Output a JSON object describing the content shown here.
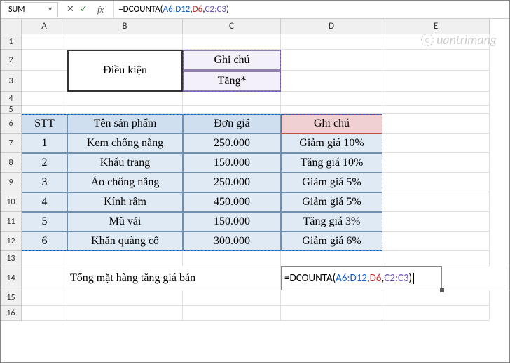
{
  "nameBox": "SUM",
  "formulaBar": {
    "prefix": "=DCOUNTA(",
    "arg1": "A6:D12",
    "sep1": ",",
    "arg2": "D6",
    "sep2": ",",
    "arg3": "C2:C3",
    "suffix": ")"
  },
  "columns": [
    "A",
    "B",
    "C",
    "D",
    "E"
  ],
  "rows": [
    "1",
    "2",
    "3",
    "4",
    "5",
    "6",
    "7",
    "8",
    "9",
    "10",
    "11",
    "12",
    "13",
    "14",
    "15",
    "16"
  ],
  "criteria": {
    "label": "Điều kiện",
    "header": "Ghi chú",
    "value": "Tăng*"
  },
  "table": {
    "headers": {
      "stt": "STT",
      "ten": "Tên sản phẩm",
      "dongia": "Đơn giá",
      "ghichu": "Ghi chú"
    },
    "rows": [
      {
        "stt": "1",
        "ten": "Kem chống nắng",
        "dongia": "250.000",
        "ghichu": "Giảm giá 10%"
      },
      {
        "stt": "2",
        "ten": "Khẩu trang",
        "dongia": "150.000",
        "ghichu": "Tăng giá 10%"
      },
      {
        "stt": "3",
        "ten": "Áo chống nắng",
        "dongia": "250.000",
        "ghichu": "Giảm giá 5%"
      },
      {
        "stt": "4",
        "ten": "Kính râm",
        "dongia": "450.000",
        "ghichu": "Giảm giá 5%"
      },
      {
        "stt": "5",
        "ten": "Mũ vải",
        "dongia": "150.000",
        "ghichu": "Tăng giá 3%"
      },
      {
        "stt": "6",
        "ten": "Khăn quàng cổ",
        "dongia": "300.000",
        "ghichu": "Giảm giá 6%"
      }
    ]
  },
  "summaryLabel": "Tổng mặt hàng tăng giá bán",
  "cellFormula": {
    "prefix": "=DCOUNTA(",
    "arg1": "A6:D12",
    "sep1": ",",
    "arg2": "D6",
    "sep2": ",",
    "arg3": "C2:C3",
    "suffix": ")"
  },
  "watermark": "uantrimang",
  "chart_data": {
    "type": "table",
    "columns": [
      "STT",
      "Tên sản phẩm",
      "Đơn giá",
      "Ghi chú"
    ],
    "rows": [
      [
        "1",
        "Kem chống nắng",
        "250.000",
        "Giảm giá 10%"
      ],
      [
        "2",
        "Khẩu trang",
        "150.000",
        "Tăng giá 10%"
      ],
      [
        "3",
        "Áo chống nắng",
        "250.000",
        "Giảm giá 5%"
      ],
      [
        "4",
        "Kính râm",
        "450.000",
        "Giảm giá 5%"
      ],
      [
        "5",
        "Mũ vải",
        "150.000",
        "Tăng giá 3%"
      ],
      [
        "6",
        "Khăn quàng cổ",
        "300.000",
        "Giảm giá 6%"
      ]
    ]
  }
}
